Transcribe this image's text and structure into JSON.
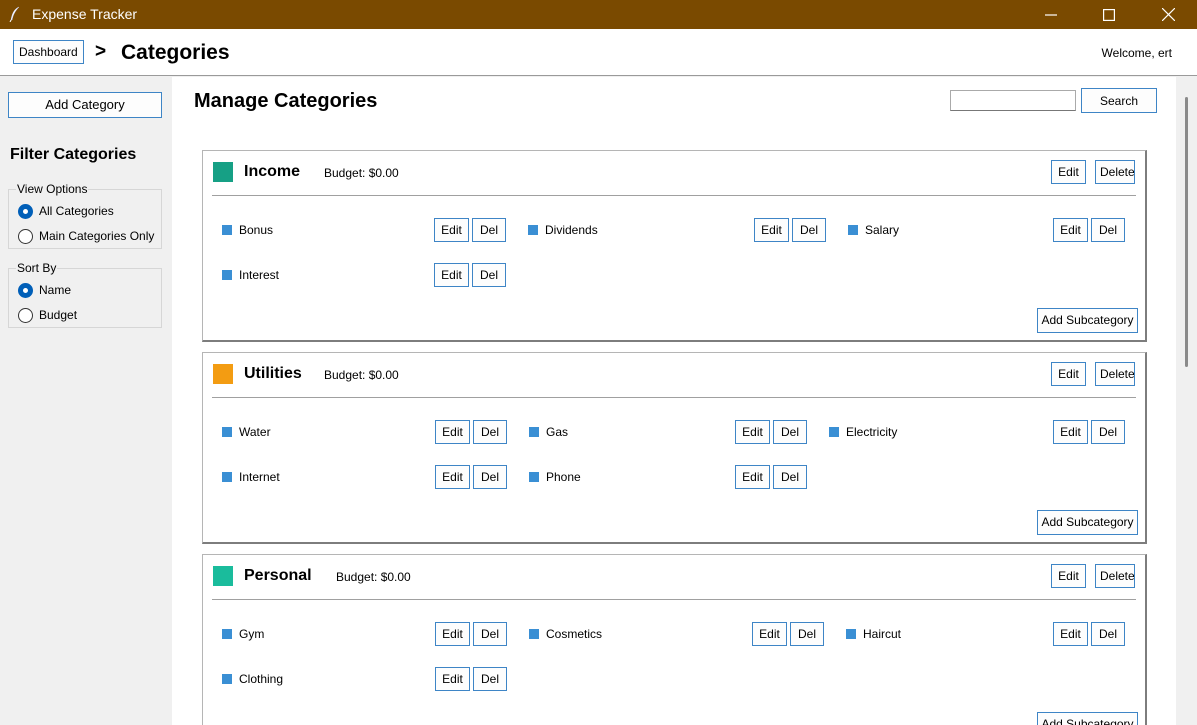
{
  "window": {
    "title": "Expense Tracker"
  },
  "header": {
    "dashboard_label": "Dashboard",
    "separator": ">",
    "page_title": "Categories",
    "welcome": "Welcome, ert"
  },
  "sidebar": {
    "add_category_label": "Add Category",
    "filter_title": "Filter Categories",
    "view_options": {
      "label": "View Options",
      "options": [
        "All Categories",
        "Main Categories Only"
      ],
      "selected": "All Categories"
    },
    "sort_by": {
      "label": "Sort By",
      "options": [
        "Name",
        "Budget"
      ],
      "selected": "Name"
    }
  },
  "main": {
    "title": "Manage Categories",
    "search": {
      "value": "",
      "button_label": "Search"
    },
    "edit_label": "Edit",
    "delete_label": "Delete",
    "del_label": "Del",
    "add_subcategory_label": "Add Subcategory",
    "categories": [
      {
        "name": "Income",
        "budget": "Budget: $0.00",
        "color": "#16a085",
        "subcategories": [
          "Bonus",
          "Dividends",
          "Salary",
          "Interest"
        ]
      },
      {
        "name": "Utilities",
        "budget": "Budget: $0.00",
        "color": "#f39c12",
        "subcategories": [
          "Water",
          "Gas",
          "Electricity",
          "Internet",
          "Phone"
        ]
      },
      {
        "name": "Personal",
        "budget": "Budget: $0.00",
        "color": "#1abc9c",
        "subcategories": [
          "Gym",
          "Cosmetics",
          "Haircut",
          "Clothing"
        ]
      }
    ]
  },
  "colors": {
    "titlebar": "#7a4a00",
    "button_border": "#3e85c6",
    "subcategory_dot": "#3a8fd4",
    "radio_selected": "#005fb8"
  }
}
